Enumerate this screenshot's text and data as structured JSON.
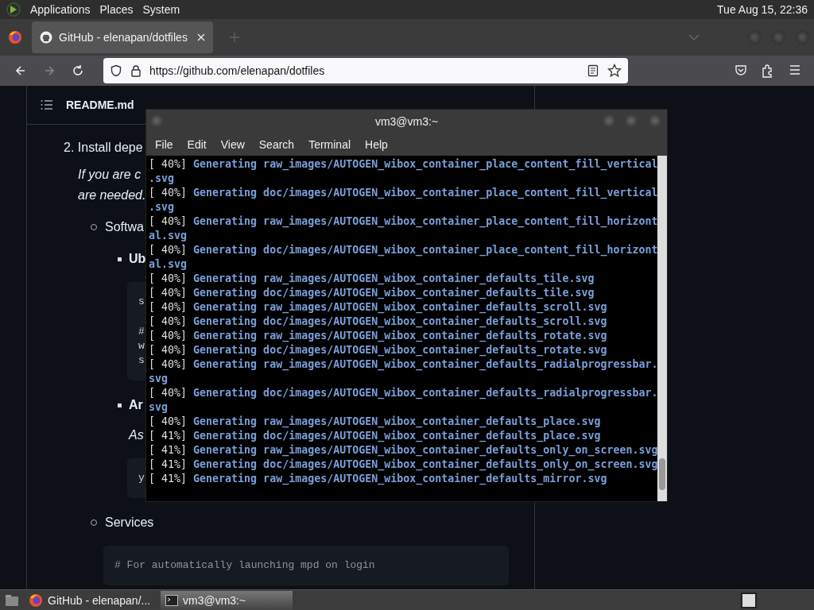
{
  "top_panel": {
    "menus": [
      "Applications",
      "Places",
      "System"
    ],
    "clock": "Tue Aug 15, 22:36"
  },
  "browser": {
    "tabs": [
      {
        "title": "GitHub - elenapan/dotfiles",
        "selected": true
      }
    ],
    "nav": [
      {
        "kind": "back",
        "disabled": false
      },
      {
        "kind": "forward",
        "disabled": true
      },
      {
        "kind": "reload",
        "disabled": false
      }
    ],
    "url": "https://github.com/elenapan/dotfiles",
    "readme": {
      "title": "README.md",
      "blocks": [
        {
          "kind": "step",
          "text": "2. Install depe"
        },
        {
          "kind": "note",
          "text": "If you are c"
        },
        {
          "kind": "note",
          "text": "are needed."
        },
        {
          "kind": "item",
          "text": "Softwa"
        },
        {
          "kind": "subitem",
          "text": "Ub"
        },
        {
          "kind": "code",
          "groups": [
            [
              "s"
            ],
            [
              "#",
              "w",
              "s"
            ]
          ]
        },
        {
          "kind": "subitem",
          "text": "Ar"
        },
        {
          "kind": "subnote",
          "text": "As"
        },
        {
          "kind": "code",
          "groups": [
            [
              "y"
            ]
          ]
        },
        {
          "kind": "item",
          "text": "Services"
        },
        {
          "kind": "code_wide",
          "groups": [
            [
              "# For automatically launching mpd on login"
            ]
          ]
        }
      ]
    }
  },
  "terminal": {
    "title": "vm3@vm3:~",
    "menus": [
      "File",
      "Edit",
      "View",
      "Search",
      "Terminal",
      "Help"
    ],
    "lines": [
      {
        "prefix": "[ 40%]",
        "text": "Generating raw_images/AUTOGEN_wibox_container_place_content_fill_vertical"
      },
      {
        "text": ".svg"
      },
      {
        "prefix": "[ 40%]",
        "text": "Generating doc/images/AUTOGEN_wibox_container_place_content_fill_vertical"
      },
      {
        "text": ".svg"
      },
      {
        "prefix": "[ 40%]",
        "text": "Generating raw_images/AUTOGEN_wibox_container_place_content_fill_horizont"
      },
      {
        "text": "al.svg"
      },
      {
        "prefix": "[ 40%]",
        "text": "Generating doc/images/AUTOGEN_wibox_container_place_content_fill_horizont"
      },
      {
        "text": "al.svg"
      },
      {
        "prefix": "[ 40%]",
        "text": "Generating raw_images/AUTOGEN_wibox_container_defaults_tile.svg"
      },
      {
        "prefix": "[ 40%]",
        "text": "Generating doc/images/AUTOGEN_wibox_container_defaults_tile.svg"
      },
      {
        "prefix": "[ 40%]",
        "text": "Generating raw_images/AUTOGEN_wibox_container_defaults_scroll.svg"
      },
      {
        "prefix": "[ 40%]",
        "text": "Generating doc/images/AUTOGEN_wibox_container_defaults_scroll.svg"
      },
      {
        "prefix": "[ 40%]",
        "text": "Generating raw_images/AUTOGEN_wibox_container_defaults_rotate.svg"
      },
      {
        "prefix": "[ 40%]",
        "text": "Generating doc/images/AUTOGEN_wibox_container_defaults_rotate.svg"
      },
      {
        "prefix": "[ 40%]",
        "text": "Generating raw_images/AUTOGEN_wibox_container_defaults_radialprogressbar."
      },
      {
        "text": "svg"
      },
      {
        "prefix": "[ 40%]",
        "text": "Generating doc/images/AUTOGEN_wibox_container_defaults_radialprogressbar."
      },
      {
        "text": "svg"
      },
      {
        "prefix": "[ 40%]",
        "text": "Generating raw_images/AUTOGEN_wibox_container_defaults_place.svg"
      },
      {
        "prefix": "[ 41%]",
        "text": "Generating doc/images/AUTOGEN_wibox_container_defaults_place.svg"
      },
      {
        "prefix": "[ 41%]",
        "text": "Generating raw_images/AUTOGEN_wibox_container_defaults_only_on_screen.svg"
      },
      {
        "prefix": "[ 41%]",
        "text": "Generating doc/images/AUTOGEN_wibox_container_defaults_only_on_screen.svg"
      },
      {
        "prefix": "[ 41%]",
        "text": "Generating raw_images/AUTOGEN_wibox_container_defaults_mirror.svg"
      }
    ]
  },
  "taskbar": {
    "tasks": [
      {
        "kind": "browser",
        "label": "GitHub - elenapan/...",
        "selected": false
      },
      {
        "kind": "terminal",
        "label": "vm3@vm3:~",
        "selected": true
      }
    ]
  }
}
